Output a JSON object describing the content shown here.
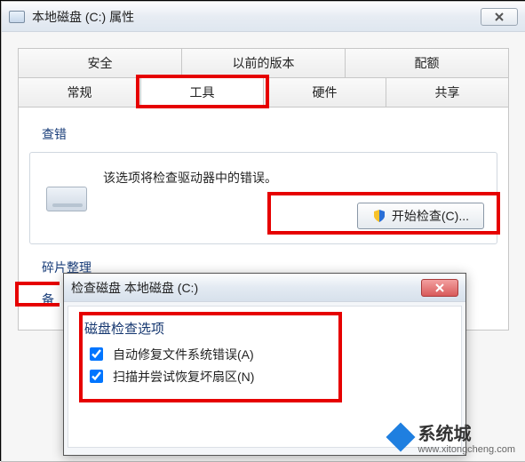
{
  "main_window": {
    "title": "本地磁盘 (C:) 属性",
    "tabs_row1": [
      "安全",
      "以前的版本",
      "配额"
    ],
    "tabs_row2": [
      "常规",
      "工具",
      "硬件",
      "共享"
    ],
    "active_tab": "工具",
    "check_group": {
      "label": "查错",
      "description": "该选项将检查驱动器中的错误。",
      "button": "开始检查(C)..."
    },
    "defrag_group": {
      "label": "碎片整理"
    },
    "backup_group": {
      "label": "备"
    }
  },
  "dialog": {
    "title": "检查磁盘 本地磁盘 (C:)",
    "options_title": "磁盘检查选项",
    "opt_fix": "自动修复文件系统错误(A)",
    "opt_scan": "扫描并尝试恢复坏扇区(N)",
    "opt_fix_checked": true,
    "opt_scan_checked": true
  },
  "watermark": {
    "brand": "系统城",
    "url": "www.xitongcheng.com"
  }
}
